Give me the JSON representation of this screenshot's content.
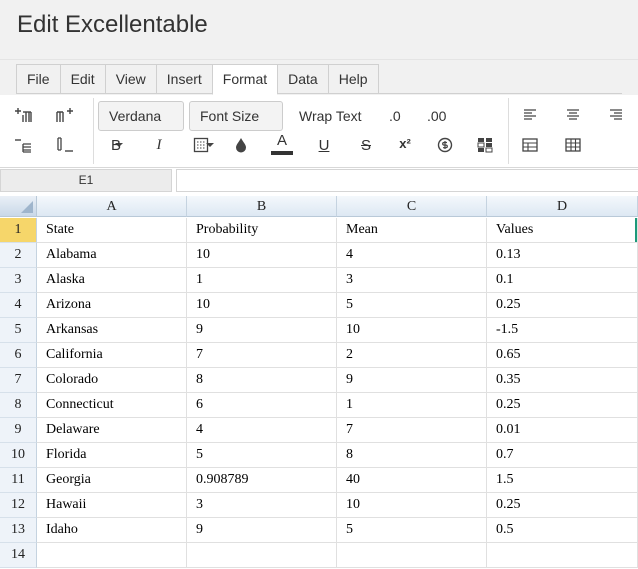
{
  "app": {
    "title": "Edit Excellentable"
  },
  "menu": {
    "items": [
      {
        "label": "File",
        "active": false
      },
      {
        "label": "Edit",
        "active": false
      },
      {
        "label": "View",
        "active": false
      },
      {
        "label": "Insert",
        "active": false
      },
      {
        "label": "Format",
        "active": true
      },
      {
        "label": "Data",
        "active": false
      },
      {
        "label": "Help",
        "active": false
      }
    ]
  },
  "ribbon": {
    "font_family": "Verdana",
    "font_size": "Font Size",
    "wrap_text": "Wrap Text",
    "decrease_decimal": ".0",
    "increase_decimal": ".00",
    "bold": "B",
    "italic": "I",
    "font_color": "A",
    "underline": "U",
    "strike": "S",
    "superscript": "x²",
    "font_color_swatch": "#333333"
  },
  "formula_bar": {
    "cell_ref": "E1",
    "value": ""
  },
  "sheet": {
    "columns": [
      "A",
      "B",
      "C",
      "D"
    ],
    "selected_row": 1,
    "rows": [
      [
        "State",
        "Probability",
        "Mean",
        "Values"
      ],
      [
        "Alabama",
        "10",
        "4",
        "0.13"
      ],
      [
        "Alaska",
        "1",
        "3",
        "0.1"
      ],
      [
        "Arizona",
        "10",
        "5",
        "0.25"
      ],
      [
        "Arkansas",
        "9",
        "10",
        "-1.5"
      ],
      [
        "California",
        "7",
        "2",
        "0.65"
      ],
      [
        "Colorado",
        "8",
        "9",
        "0.35"
      ],
      [
        "Connecticut",
        "6",
        "1",
        "0.25"
      ],
      [
        "Delaware",
        "4",
        "7",
        "0.01"
      ],
      [
        "Florida",
        "5",
        "8",
        "0.7"
      ],
      [
        "Georgia",
        "0.908789",
        "40",
        "1.5"
      ],
      [
        "Hawaii",
        "3",
        "10",
        "0.25"
      ],
      [
        "Idaho",
        "9",
        "5",
        "0.5"
      ],
      [
        "",
        "",
        "",
        ""
      ]
    ]
  }
}
